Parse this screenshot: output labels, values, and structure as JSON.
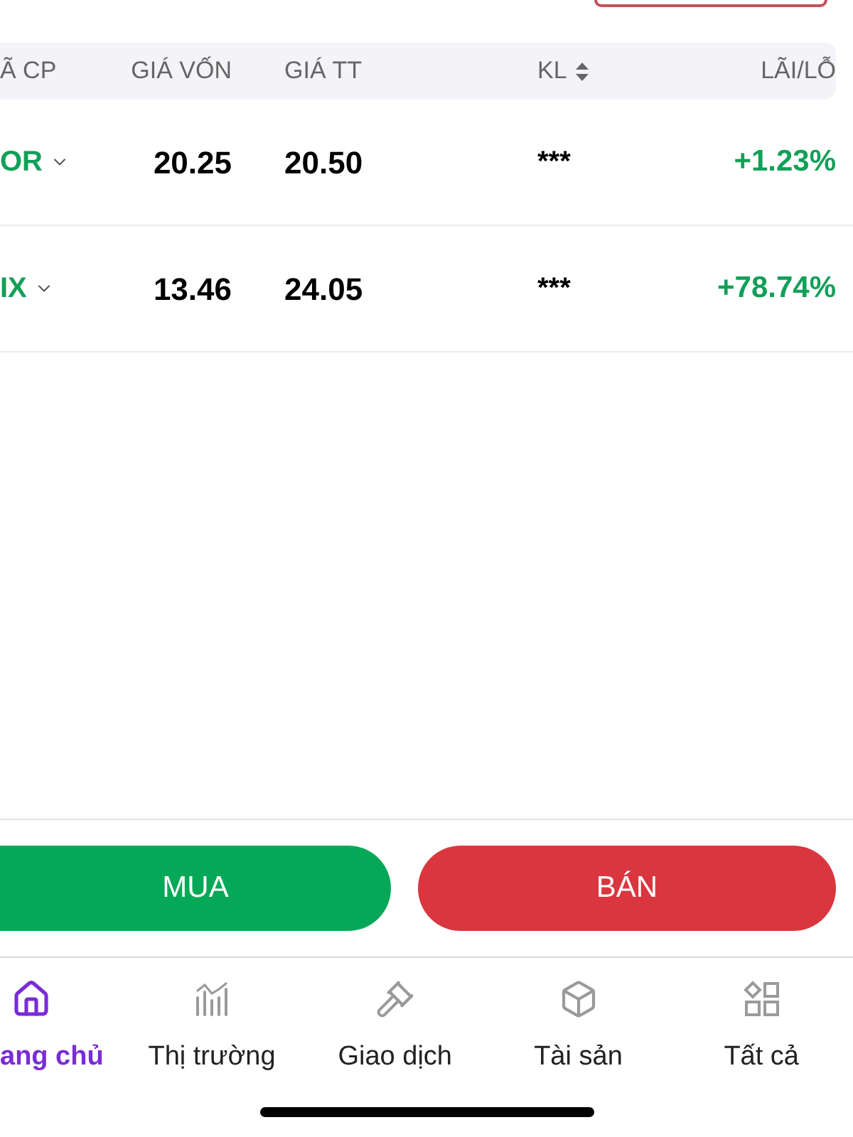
{
  "holdings_table": {
    "columns": [
      {
        "label": "Ã CP",
        "sortable": false
      },
      {
        "label": "GIÁ VỐN",
        "sortable": false
      },
      {
        "label": "GIÁ TT",
        "sortable": false
      },
      {
        "label": "KL",
        "sortable": true
      },
      {
        "label": "LÃI/LỖ",
        "sortable": false
      }
    ],
    "rows": [
      {
        "ticker": "OR",
        "cost_price": "20.25",
        "market_price": "20.50",
        "volume": "***",
        "profit_loss": "+1.23%"
      },
      {
        "ticker": "IX",
        "cost_price": "13.46",
        "market_price": "24.05",
        "volume": "***",
        "profit_loss": "+78.74%"
      }
    ]
  },
  "actions": [
    {
      "label": "MUA",
      "kind": "buy"
    },
    {
      "label": "BÁN",
      "kind": "sell"
    }
  ],
  "bottom_nav": [
    {
      "label": "ang chủ",
      "selected": true
    },
    {
      "label": "Thị trường",
      "selected": false
    },
    {
      "label": "Giao dịch",
      "selected": false
    },
    {
      "label": "Tài sản",
      "selected": false
    },
    {
      "label": "Tất cả",
      "selected": false
    }
  ]
}
